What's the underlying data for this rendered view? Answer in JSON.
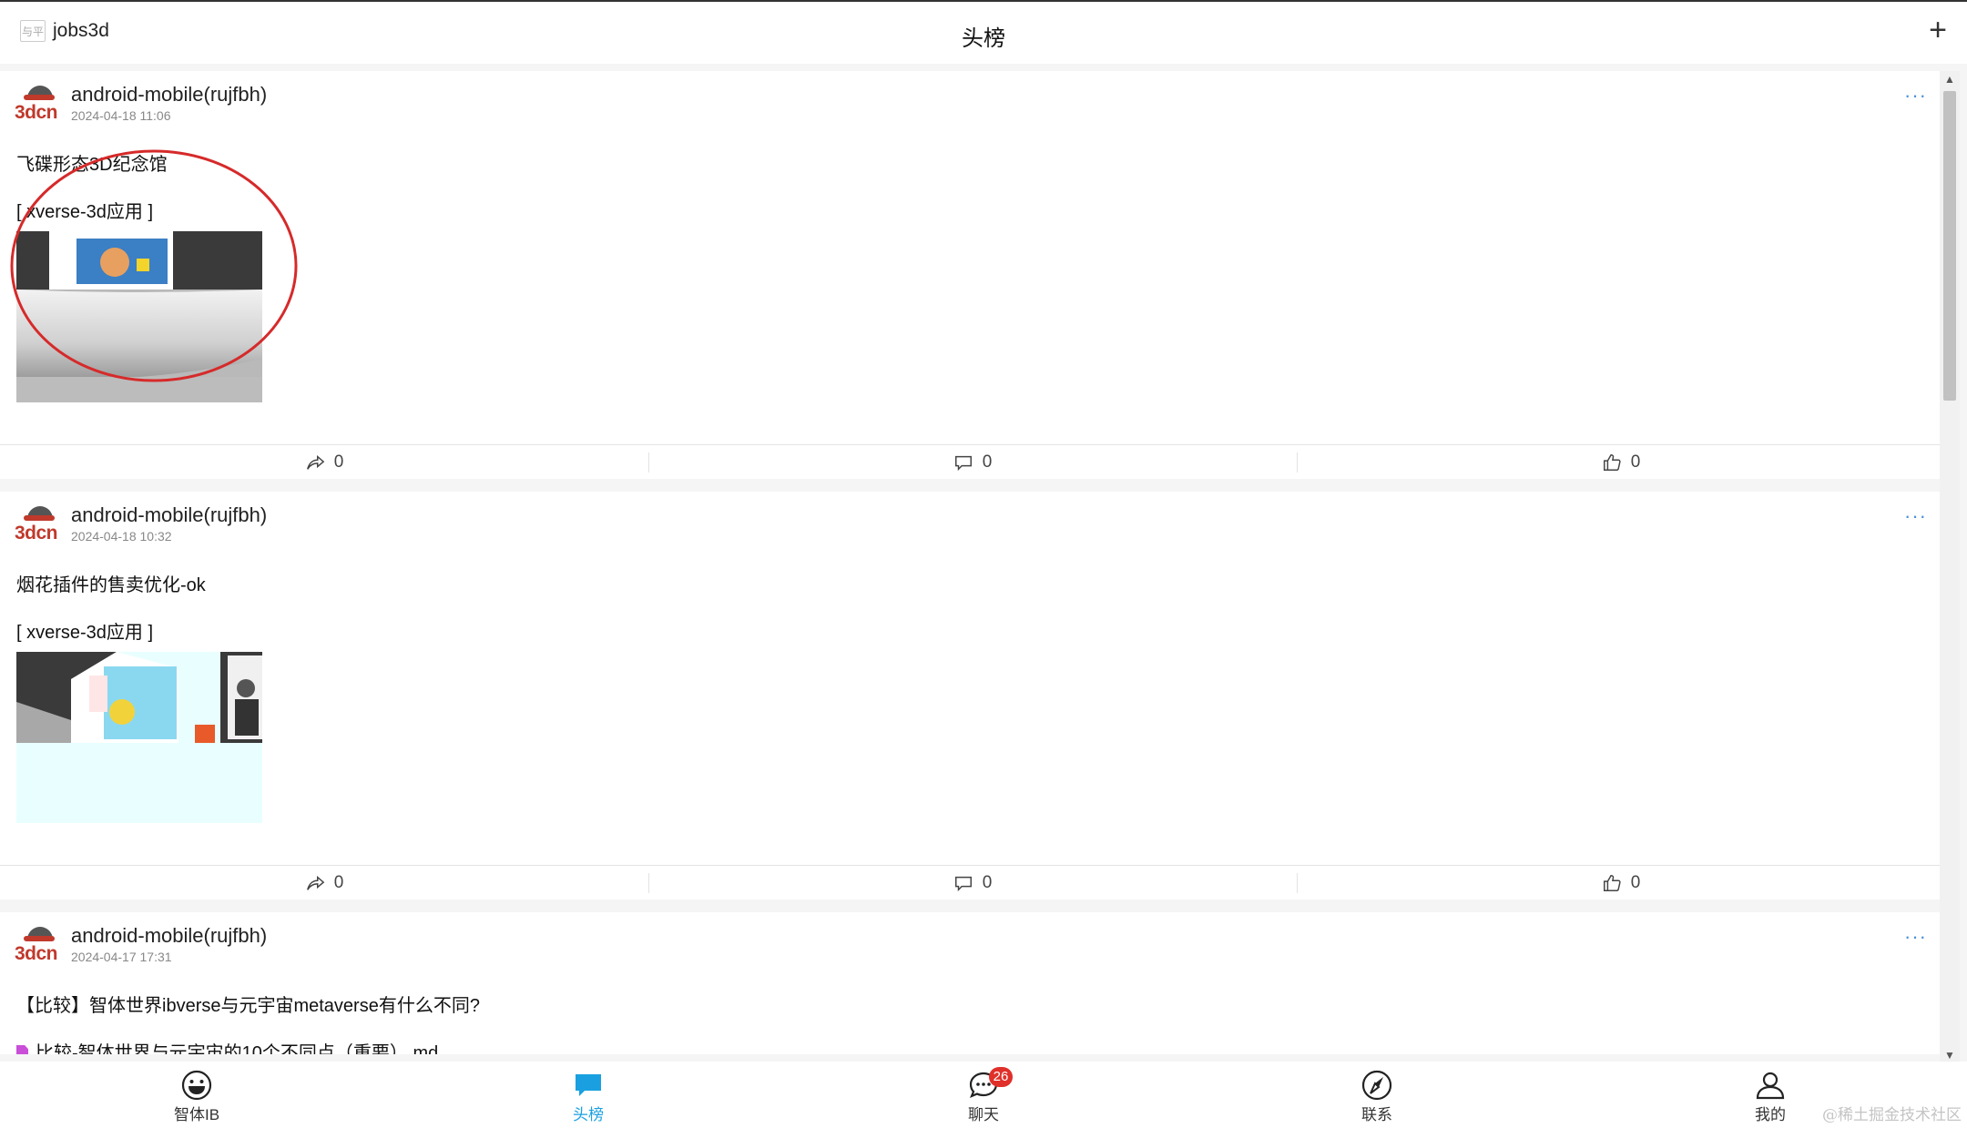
{
  "topbar": {
    "brand_name": "jobs3d",
    "logo_text": "与平",
    "title": "头榜",
    "plus": "+"
  },
  "posts": [
    {
      "avatar_text": "3dcn",
      "author": "android-mobile(rujfbh)",
      "time": "2024-04-18 11:06",
      "more": "···",
      "content": "飞碟形态3D纪念馆",
      "tag": "[ xverse-3d应用 ]",
      "shares": "0",
      "comments": "0",
      "likes": "0"
    },
    {
      "avatar_text": "3dcn",
      "author": "android-mobile(rujfbh)",
      "time": "2024-04-18 10:32",
      "more": "···",
      "content": "烟花插件的售卖优化-ok",
      "tag": "[ xverse-3d应用 ]",
      "shares": "0",
      "comments": "0",
      "likes": "0"
    },
    {
      "avatar_text": "3dcn",
      "author": "android-mobile(rujfbh)",
      "time": "2024-04-17 17:31",
      "more": "···",
      "content": "【比较】智体世界ibverse与元宇宙metaverse有什么不同?",
      "file": "比较-智体世界与元宇宙的10个不同点（重要）.md"
    }
  ],
  "nav": [
    {
      "label": "智体IB",
      "icon": "smiley-icon"
    },
    {
      "label": "头榜",
      "icon": "chat-bubble-icon",
      "active": true
    },
    {
      "label": "聊天",
      "icon": "chat-icon",
      "badge": "26"
    },
    {
      "label": "联系",
      "icon": "compass-icon"
    },
    {
      "label": "我的",
      "icon": "user-icon"
    }
  ],
  "colors": {
    "accent": "#1aa0e0",
    "badge": "#e0302a",
    "brand_red": "#c0392b",
    "annotation_red": "#d62a2a"
  },
  "watermark": "@稀土掘金技术社区"
}
